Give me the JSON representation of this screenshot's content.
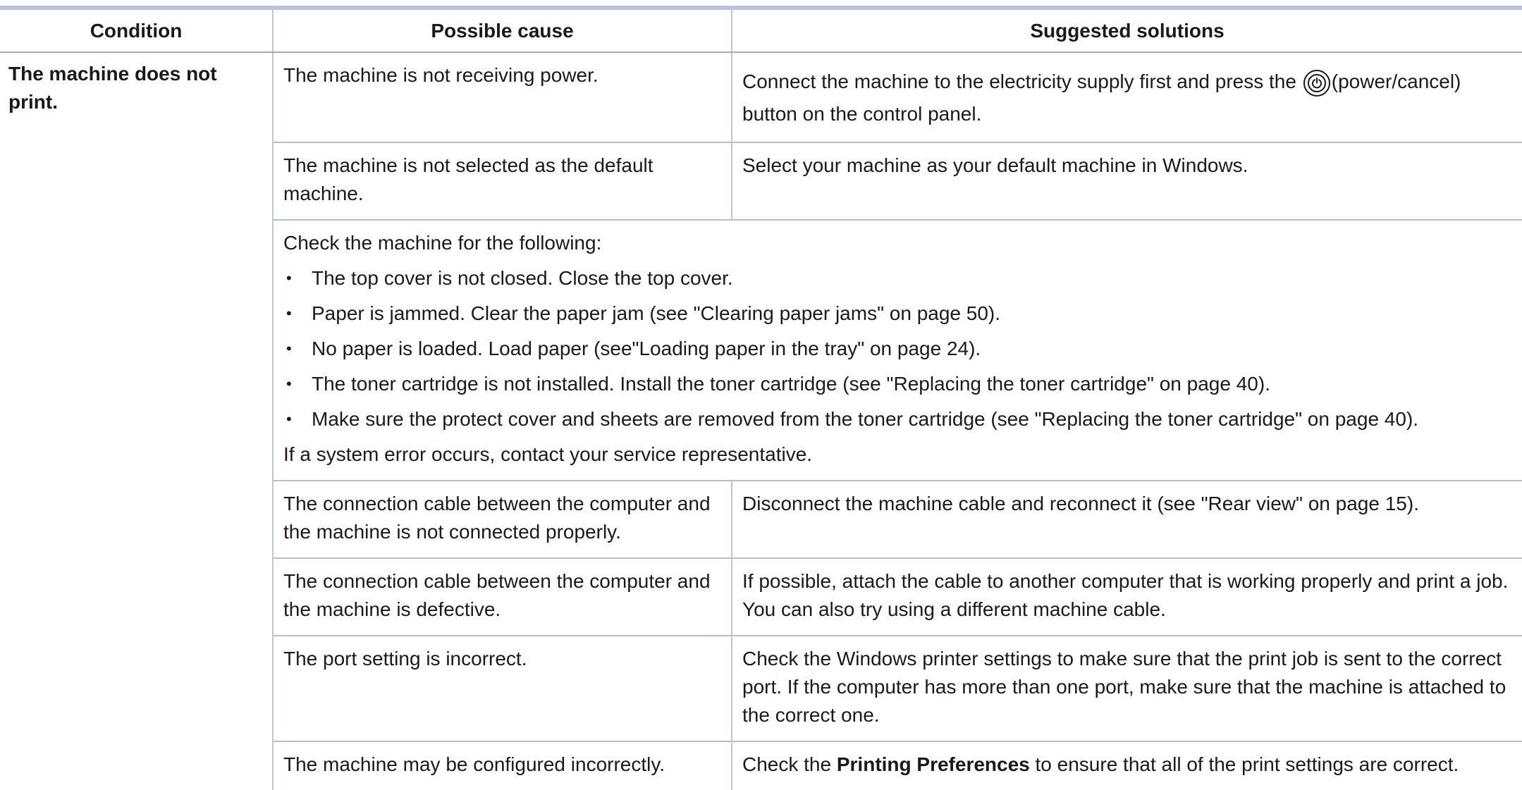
{
  "headers": {
    "condition": "Condition",
    "cause": "Possible cause",
    "solutions": "Suggested solutions"
  },
  "condition": "The machine does not print.",
  "rows": [
    {
      "cause": "The machine is not receiving power.",
      "solution_before_icon": "Connect the machine to the electricity supply first and press the",
      "solution_icon": "power-icon",
      "solution_after_icon": "(power/cancel) button on the control panel."
    },
    {
      "cause": "The machine is not selected as the default machine.",
      "solution": "Select your machine as your default machine in Windows."
    }
  ],
  "check_block": {
    "intro": "Check the machine for the following:",
    "items": [
      "The top cover is not closed. Close the top cover.",
      "Paper is jammed. Clear the paper jam (see \"Clearing paper jams\" on page 50).",
      "No paper is loaded. Load paper (see\"Loading paper in the tray\" on page 24).",
      "The toner cartridge is not installed. Install the toner cartridge (see \"Replacing the toner cartridge\" on page 40).",
      "Make sure the protect cover and sheets are removed from the toner cartridge (see \"Replacing the toner cartridge\" on page 40)."
    ],
    "footer": "If a system error occurs, contact your service representative."
  },
  "rows_after": [
    {
      "cause": "The connection cable between the computer and the machine is not connected properly.",
      "solution": "Disconnect the machine cable and reconnect it (see \"Rear view\" on page 15)."
    },
    {
      "cause": "The connection cable between the computer and the machine is defective.",
      "solution": "If possible, attach the cable to another computer that is working properly and print a job. You can also try using a different machine cable."
    },
    {
      "cause": "The port setting is incorrect.",
      "solution": "Check the Windows printer settings to make sure that the print job is sent to the correct port. If the computer has more than one port, make sure that the machine is attached to the correct one."
    },
    {
      "cause": "The machine may be configured incorrectly.",
      "solution_prefix": "Check the",
      "solution_bold": "Printing Preferences",
      "solution_suffix": "to ensure that all of the print settings are correct."
    }
  ]
}
